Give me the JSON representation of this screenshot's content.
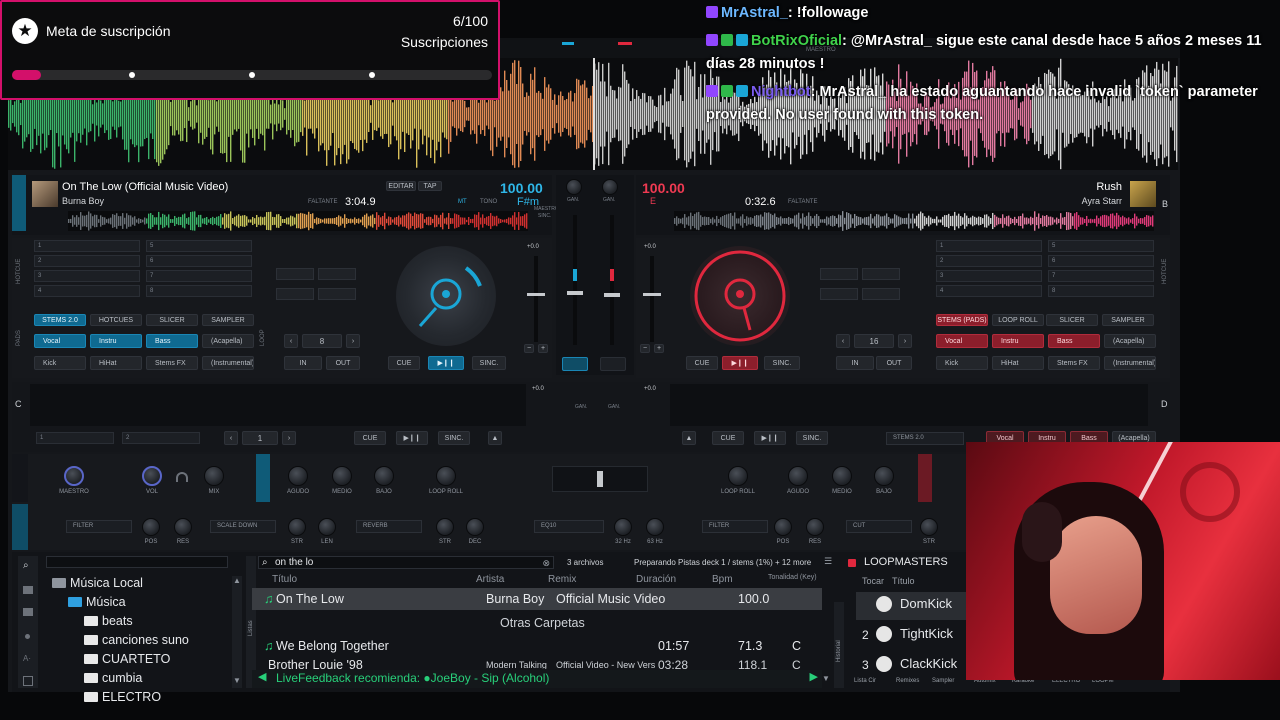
{
  "overlay": {
    "title": "Meta de suscripción",
    "count": "6/100",
    "subtitle": "Suscripciones",
    "progress_fraction": 0.06
  },
  "chat": {
    "messages": [
      {
        "user": "MrAstral_",
        "user_color": "#6db8ff",
        "text": ": !followage"
      },
      {
        "user": "BotRixOficial",
        "user_color": "#3fd24b",
        "text": ": @MrAstral_ sigue este canal desde hace 5 años 2 meses 11 días 28 minutos !"
      },
      {
        "user": "Nightbot",
        "user_color": "#7a5cf0",
        "text": ": MrAstral_ ha estado aguantando hace invalid `token` parameter provided. No user found with this token."
      }
    ]
  },
  "deck_a": {
    "title": "On The Low",
    "remix": "(Official Music Video)",
    "artist": "Burna Boy",
    "remaining_label": "FALTANTE",
    "time": "3:04.9",
    "bpm": "100.00",
    "key": "F#m",
    "edit": "EDITAR",
    "tap": "TAP",
    "mt": "MT",
    "tono": "TONO",
    "maestro": "MAESTRO",
    "sinc": "SINC.",
    "loop_size": "8",
    "pitch": "+0.0",
    "tabs": [
      "STEMS 2.0",
      "HOTCUES",
      "SLICER",
      "SAMPLER"
    ],
    "pads": [
      "Vocal",
      "Instru",
      "Bass",
      "(Acapella)",
      "Kick",
      "HiHat",
      "Stems FX",
      "(Instrumental)"
    ],
    "cue": "CUE",
    "sync": "SINC.",
    "in": "IN",
    "out": "OUT",
    "letter": "A"
  },
  "deck_b": {
    "title": "Rush",
    "artist": "Ayra Starr",
    "remaining_label": "FALTANTE",
    "time": "0:32.6",
    "bpm": "100.00",
    "key": "E",
    "loop_size": "16",
    "pitch": "+0.0",
    "tabs": [
      "STEMS (PADS)",
      "LOOP ROLL",
      "SLICER",
      "SAMPLER"
    ],
    "pads": [
      "Vocal",
      "Instru",
      "Bass",
      "(Acapella)",
      "Kick",
      "HiHat",
      "Stems FX",
      "(Instrumental)"
    ],
    "cue": "CUE",
    "sync": "SINC.",
    "in": "IN",
    "out": "OUT",
    "letter": "B"
  },
  "deck_c": {
    "letter": "C",
    "loop": "1",
    "cue": "CUE",
    "sync": "SINC.",
    "slot1": "1",
    "slot2": "2",
    "pitch": "+0.0"
  },
  "deck_d": {
    "letter": "D",
    "cue": "CUE",
    "sync": "SINC.",
    "stems": "STEMS 2.0",
    "pads": [
      "Vocal",
      "Instru",
      "Bass",
      "(Acapella)"
    ],
    "pitch": "+0.0"
  },
  "mixer": {
    "gan": "GAN.",
    "labels_left": [
      "MAESTRO",
      "VOL",
      "MIX",
      "AGUDO",
      "MEDIO",
      "BAJO",
      "LOOP ROLL"
    ],
    "labels_right": [
      "LOOP ROLL",
      "AGUDO",
      "MEDIO",
      "BAJO"
    ],
    "fx_left": {
      "filter": "FILTER",
      "pos": "POS",
      "res": "RES",
      "scale": "SCALE DOWN",
      "str": "STR",
      "len": "LEN",
      "reverb": "REVERB",
      "str2": "STR",
      "dec": "DEC"
    },
    "fx_center": {
      "eq": "EQ10",
      "hz1": "32 Hz",
      "hz2": "63 Hz"
    },
    "fx_right": {
      "filter": "FILTER",
      "pos": "POS",
      "res": "RES",
      "cut": "CUT",
      "str": "STR"
    },
    "maestro_label": "MAESTRO",
    "deck_a_label": "DECK A",
    "deck_b_label": "DECK B"
  },
  "hotcues_a": [
    "1",
    "2",
    "3",
    "4",
    "5",
    "6",
    "7",
    "8"
  ],
  "hotcues_b": [
    "1",
    "2",
    "3",
    "4",
    "5",
    "6",
    "7",
    "8"
  ],
  "browser": {
    "tree": [
      {
        "label": "Música Local",
        "level": 0,
        "icon": "computer-icon"
      },
      {
        "label": "Música",
        "level": 1,
        "icon": "music-folder-icon"
      },
      {
        "label": "beats",
        "level": 2,
        "icon": "folder-icon"
      },
      {
        "label": "canciones suno",
        "level": 2,
        "icon": "folder-icon"
      },
      {
        "label": "CUARTETO",
        "level": 2,
        "icon": "folder-icon"
      },
      {
        "label": "cumbia",
        "level": 2,
        "icon": "folder-icon"
      },
      {
        "label": "ELECTRO",
        "level": 2,
        "icon": "folder-icon"
      }
    ],
    "search_value": "on the lo",
    "file_count": "3 archivos",
    "status": "Preparando Pistas deck 1 / stems (1%) + 12 more",
    "columns": [
      "Título",
      "Artista",
      "Remix",
      "Duración",
      "Bpm",
      "Tonalidad (Key)"
    ],
    "tracks": [
      {
        "title": "On The Low",
        "artist": "Burna Boy",
        "remix": "Official Music Video",
        "duration": "",
        "bpm": "100.0",
        "key": ""
      }
    ],
    "other_folders": "Otras Carpetas",
    "other_tracks": [
      {
        "title": "We Belong Together",
        "artist": "",
        "remix": "",
        "duration": "01:57",
        "bpm": "71.3",
        "key": "C"
      },
      {
        "title": "Brother Louie '98",
        "artist": "Modern Talking",
        "remix": "Official Video - New Vers",
        "duration": "03:28",
        "bpm": "118.1",
        "key": "C"
      }
    ],
    "feedback": "LiveFeedback recomienda: ●JoeBoy - Sip (Alcohol)",
    "side_tabs": [
      "Listas",
      "Historial"
    ]
  },
  "loopmasters": {
    "header": "LOOPMASTERS",
    "col1": "Tocar",
    "col2": "Título",
    "items": [
      {
        "num": "",
        "name": "DomKick"
      },
      {
        "num": "2",
        "name": "TightKick"
      },
      {
        "num": "3",
        "name": "ClackKick"
      }
    ],
    "bottom_tabs": [
      "Lista Cir",
      "Remixes",
      "Sampler",
      "Automix",
      "Karaoke",
      "ELECTRO",
      "LOOPM"
    ]
  },
  "topbar": {
    "maestro": "MAESTRO"
  },
  "colors": {
    "accent_blue": "#1aa6d6",
    "accent_red": "#e0283e",
    "overlay_pink": "#d3106a",
    "chat_user_green": "#3fd24b"
  }
}
